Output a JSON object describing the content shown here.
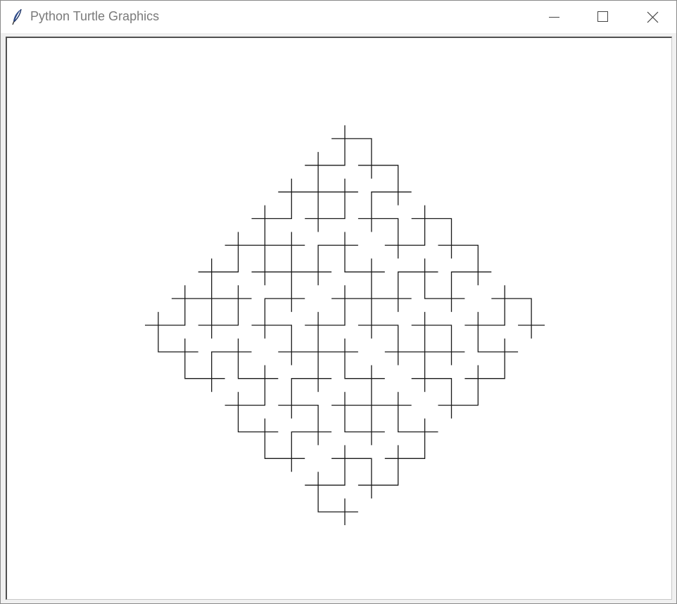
{
  "window": {
    "title": "Python Turtle Graphics",
    "icon": "feather-icon"
  },
  "controls": {
    "minimize_icon": "minimize-icon",
    "maximize_icon": "maximize-icon",
    "close_icon": "close-icon"
  },
  "canvas": {
    "drawing": "hilbert-curve-diamond",
    "line_color": "#1a1a1a",
    "background": "#ffffff"
  }
}
